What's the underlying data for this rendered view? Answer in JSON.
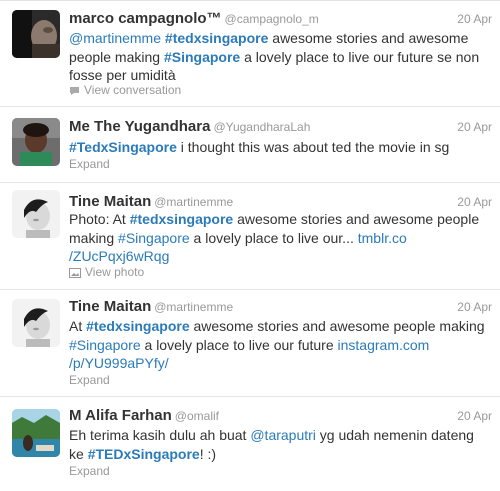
{
  "tweets": [
    {
      "name": "marco campagnolo™",
      "handle": "@campagnolo_m",
      "time": "20 Apr",
      "parts": [
        {
          "t": "link",
          "v": "@martinemme"
        },
        {
          "t": "text",
          "v": " "
        },
        {
          "t": "tag",
          "v": "#tedxsingapore"
        },
        {
          "t": "text",
          "v": " awesome stories and awesome people making "
        },
        {
          "t": "tag",
          "v": "#Singapore"
        },
        {
          "t": "text",
          "v": " a lovely place to live our future se non fosse per umidità"
        }
      ],
      "action_icon": "speech-bubble-icon",
      "action": "View conversation"
    },
    {
      "name": "Me The Yugandhara",
      "handle": "@YugandharaLah",
      "time": "20 Apr",
      "parts": [
        {
          "t": "tag",
          "v": "#TedxSingapore"
        },
        {
          "t": "text",
          "v": " i thought this was about ted the movie in sg"
        }
      ],
      "action_icon": "",
      "action": "Expand"
    },
    {
      "name": "Tine Maitan",
      "handle": "@martinemme",
      "time": "20 Apr",
      "parts": [
        {
          "t": "text",
          "v": "Photo: At "
        },
        {
          "t": "tag",
          "v": "#tedxsingapore"
        },
        {
          "t": "text",
          "v": " awesome stories and awesome people making "
        },
        {
          "t": "tag",
          "v": "#Singapore"
        },
        {
          "t": "text",
          "v": " a lovely place to live our... "
        },
        {
          "t": "link",
          "v": "tmblr.co"
        },
        {
          "t": "br",
          "v": ""
        },
        {
          "t": "link",
          "v": "/ZUcPqxj6wRqg"
        }
      ],
      "action_icon": "photo-icon",
      "action": "View photo"
    },
    {
      "name": "Tine Maitan",
      "handle": "@martinemme",
      "time": "20 Apr",
      "parts": [
        {
          "t": "text",
          "v": "At "
        },
        {
          "t": "tag",
          "v": "#tedxsingapore"
        },
        {
          "t": "text",
          "v": " awesome stories and awesome people making "
        },
        {
          "t": "tag",
          "v": "#Singapore"
        },
        {
          "t": "text",
          "v": " a lovely place to live our future "
        },
        {
          "t": "link",
          "v": "instagram.com"
        },
        {
          "t": "br",
          "v": ""
        },
        {
          "t": "link",
          "v": "/p/YU999aPYfy/"
        }
      ],
      "action_icon": "",
      "action": "Expand"
    },
    {
      "name": "M Alifa Farhan",
      "handle": "@omalif",
      "time": "20 Apr",
      "parts": [
        {
          "t": "text",
          "v": "Eh terima kasih dulu ah buat "
        },
        {
          "t": "link",
          "v": "@taraputri"
        },
        {
          "t": "text",
          "v": " yg udah nemenin dateng ke "
        },
        {
          "t": "tag",
          "v": "#TEDxSingapore"
        },
        {
          "t": "text",
          "v": "! :)"
        }
      ],
      "action_icon": "",
      "action": "Expand"
    }
  ],
  "colors": {
    "link": "#2b7bb9",
    "muted": "#999999",
    "text": "#333333",
    "divider": "#e6e6e6"
  }
}
